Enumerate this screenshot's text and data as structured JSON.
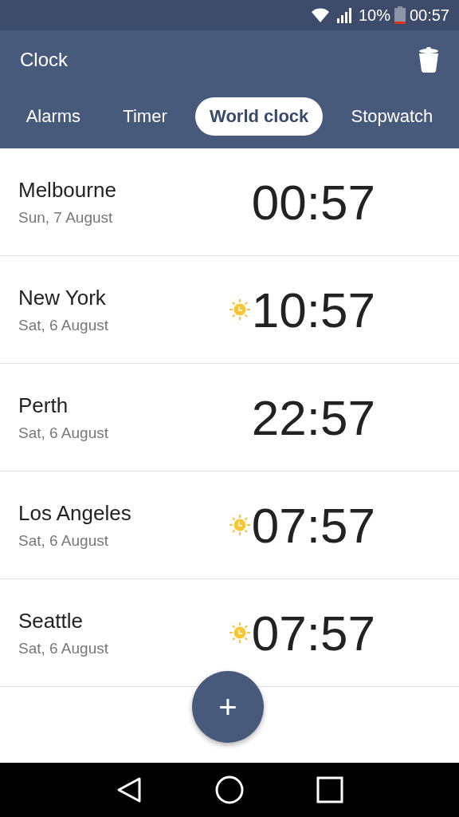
{
  "status_bar": {
    "battery": "10%",
    "time": "00:57"
  },
  "app_bar": {
    "title": "Clock"
  },
  "tabs": [
    {
      "label": "Alarms",
      "selected": false
    },
    {
      "label": "Timer",
      "selected": false
    },
    {
      "label": "World clock",
      "selected": true
    },
    {
      "label": "Stopwatch",
      "selected": false
    }
  ],
  "cities": [
    {
      "name": "Melbourne",
      "date": "Sun, 7 August",
      "time": "00:57",
      "daytime": false
    },
    {
      "name": "New York",
      "date": "Sat, 6 August",
      "time": "10:57",
      "daytime": true
    },
    {
      "name": "Perth",
      "date": "Sat, 6 August",
      "time": "22:57",
      "daytime": false
    },
    {
      "name": "Los Angeles",
      "date": "Sat, 6 August",
      "time": "07:57",
      "daytime": true
    },
    {
      "name": "Seattle",
      "date": "Sat, 6 August",
      "time": "07:57",
      "daytime": true
    }
  ],
  "add_button": {
    "label": "+"
  }
}
